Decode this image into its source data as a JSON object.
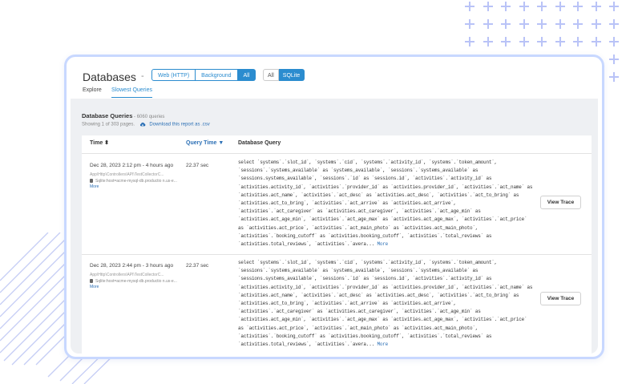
{
  "header": {
    "title": "Databases",
    "separator": "-",
    "filters": [
      {
        "label": "Web (HTTP)",
        "active": false
      },
      {
        "label": "Background",
        "active": false
      },
      {
        "label": "All",
        "active": true
      }
    ],
    "db_filters": [
      {
        "label": "All",
        "active": false
      },
      {
        "label": "SQLite",
        "active": true
      }
    ]
  },
  "tabs": [
    {
      "label": "Explore",
      "active": false
    },
    {
      "label": "Slowest Queries",
      "active": true
    }
  ],
  "section": {
    "title": "Database Queries",
    "count": " - 6060 queries",
    "showing": "Showing 1 of 303 pages.",
    "download": "Download this report as .csv"
  },
  "table": {
    "columns": [
      {
        "label": "Time ⬍",
        "sorted": false
      },
      {
        "label": "Query Time ▼",
        "sorted": true
      },
      {
        "label": "Database Query",
        "sorted": false
      }
    ],
    "rows": [
      {
        "time": "Dec 28, 2023 2:12 pm - 4 hours ago",
        "path": "App\\Http\\Controllers\\API\\TestCollectorC...",
        "connection": "Sqlite:host=acme-mysql-db.productio n.us-e...",
        "connection_more": "More",
        "query_time": "22.37 sec",
        "query": "select `systems`.`slot_id`, `systems`.`cid`, `systems`.`activity_id`, `systems`.`token_amount`, `sessions`.`systems_available` as `systems_available`, `sessions`.`systems_available` as `sessions.systems_available`, `sessions`.`id` as `sessions.id`, `activities`.`activity_id` as `activities.activity_id`, `activities`.`provider_id` as `activities.provider_id`, `activities`.`act_name` as `activities.act_name`, `activities`.`act_desc` as `activities.act_desc`, `activities`.`act_to_bring` as `activities.act_to_bring`, `activities`.`act_arrive` as `activities.act_arrive`, `activities`.`act_caregiver` as `activities.act_caregiver`, `activities`.`act_age_min` as `activities.act_age_min`, `activities`.`act_age_max` as `activities.act_age_max`, `activities`.`act_price` as `activities.act_price`, `activities`.`act_main_photo` as `activities.act_main_photo`, `activities`.`booking_cutoff` as `activities.booking_cutoff`, `activities`.`total_reviews` as `activities.total_reviews`, `activities`.`avera...",
        "query_more": "More",
        "action": "View Trace"
      },
      {
        "time": "Dec 28, 2023 2:44 pm - 3 hours ago",
        "path": "App\\Http\\Controllers\\API\\TestCollectorC...",
        "connection": "Sqlite:host=acme-mysql-db.productio n.us-e...",
        "connection_more": "More",
        "query_time": "22.37 sec",
        "query": "select `systems`.`slot_id`, `systems`.`cid`, `systems`.`activity_id`, `systems`.`token_amount`, `sessions`.`systems_available` as `systems_available`, `sessions`.`systems_available` as `sessions.systems_available`, `sessions`.`id` as `sessions.id`, `activities`.`activity_id` as `activities.activity_id`, `activities`.`provider_id` as `activities.provider_id`, `activities`.`act_name` as `activities.act_name`, `activities`.`act_desc` as `activities.act_desc`, `activities`.`act_to_bring` as `activities.act_to_bring`, `activities`.`act_arrive` as `activities.act_arrive`, `activities`.`act_caregiver` as `activities.act_caregiver`, `activities`.`act_age_min` as `activities.act_age_min`, `activities`.`act_age_max` as `activities.act_age_max`, `activities`.`act_price` as `activities.act_price`, `activities`.`act_main_photo` as `activities.act_main_photo`, `activities`.`booking_cutoff` as `activities.booking_cutoff`, `activities`.`total_reviews` as `activities.total_reviews`, `activities`.`avera...",
        "query_more": "More",
        "action": "View Trace"
      }
    ]
  },
  "colors": {
    "accent": "#2b8ccf",
    "link": "#2b6fb5",
    "frame_border": "#c8d8ff",
    "decor_plus": "#b9c3f7",
    "panel_bg": "#eef0f3"
  },
  "icons": {
    "download": "cloud-download-icon",
    "connection": "database-icon",
    "decor": "plus-icon"
  }
}
